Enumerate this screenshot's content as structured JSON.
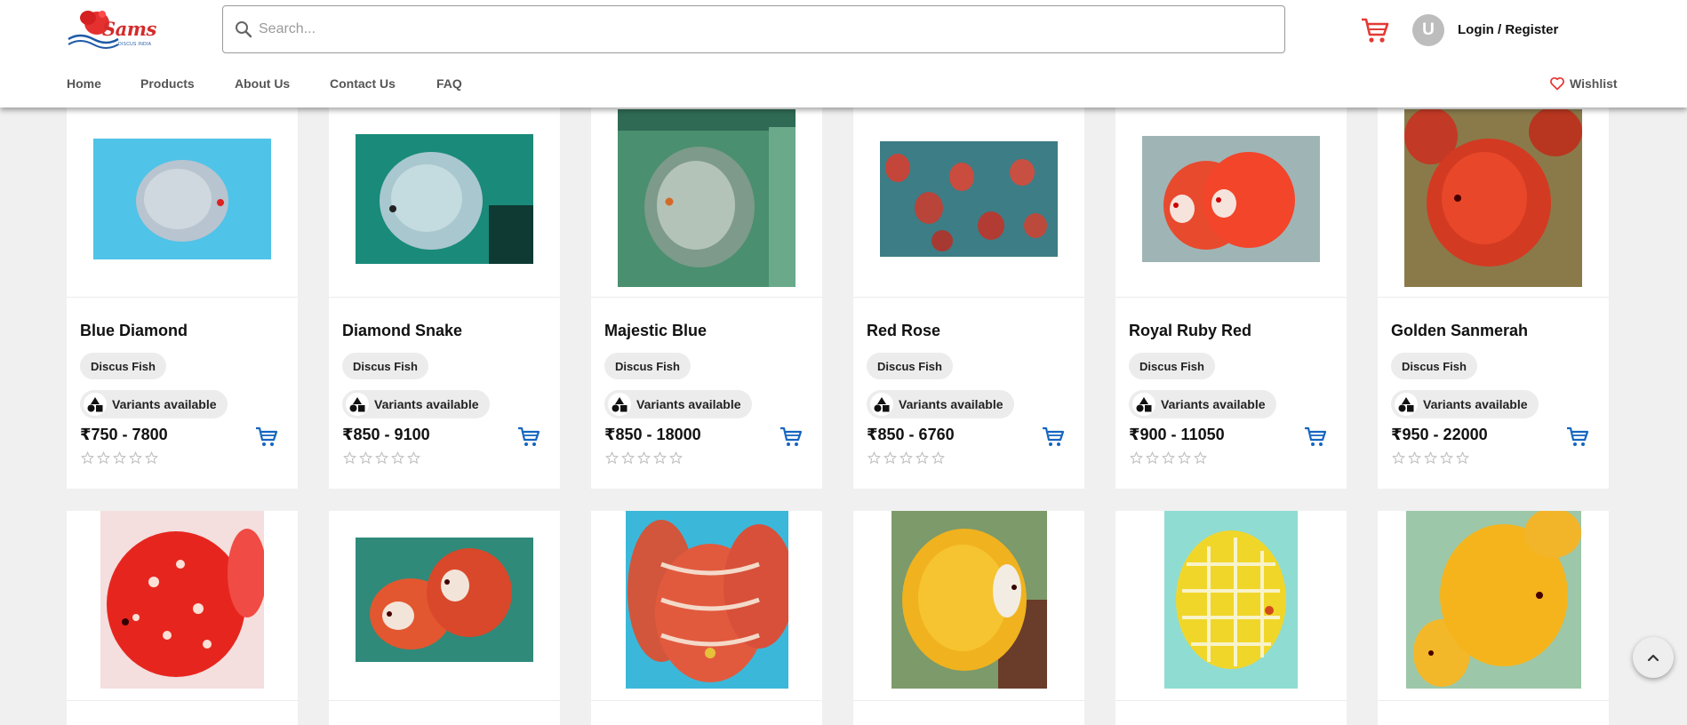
{
  "brand": {
    "name": "Sams",
    "tagline": "DISCUS INDIA"
  },
  "search": {
    "placeholder": "Search..."
  },
  "header": {
    "avatar_initial": "U",
    "login_label": "Login / Register"
  },
  "nav": {
    "items": [
      {
        "label": "Home"
      },
      {
        "label": "Products"
      },
      {
        "label": "About Us"
      },
      {
        "label": "Contact Us"
      },
      {
        "label": "FAQ"
      }
    ],
    "wishlist_label": "Wishlist"
  },
  "colors": {
    "accent_blue": "#1565c0",
    "cart_red": "#e53935",
    "page_bg": "#f0f0f0"
  },
  "products": [
    {
      "name": "Blue Diamond",
      "category": "Discus Fish",
      "variants_label": "Variants available",
      "price": "₹750 - 7800",
      "rating": 0
    },
    {
      "name": "Diamond Snake",
      "category": "Discus Fish",
      "variants_label": "Variants available",
      "price": "₹850 - 9100",
      "rating": 0
    },
    {
      "name": "Majestic Blue",
      "category": "Discus Fish",
      "variants_label": "Variants available",
      "price": "₹850 - 18000",
      "rating": 0
    },
    {
      "name": "Red Rose",
      "category": "Discus Fish",
      "variants_label": "Variants available",
      "price": "₹850 - 6760",
      "rating": 0
    },
    {
      "name": "Royal Ruby Red",
      "category": "Discus Fish",
      "variants_label": "Variants available",
      "price": "₹900 - 11050",
      "rating": 0
    },
    {
      "name": "Golden Sanmerah",
      "category": "Discus Fish",
      "variants_label": "Variants available",
      "price": "₹950 - 22000",
      "rating": 0
    }
  ]
}
